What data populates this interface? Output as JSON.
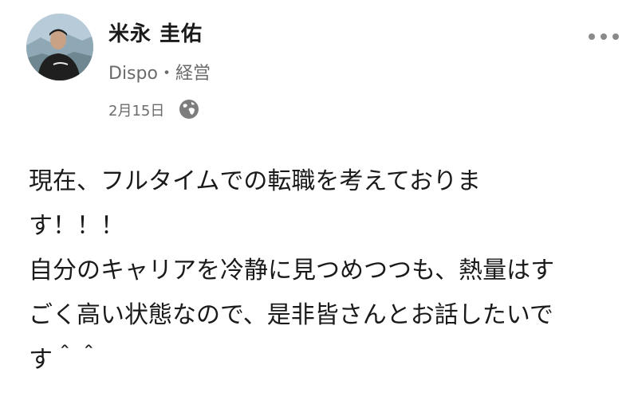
{
  "author": {
    "name": "米永 圭佑",
    "meta": "Dispo・経営"
  },
  "post": {
    "date": "2月15日",
    "lines": [
      "現在、フルタイムでの転職を考えておりま",
      "す！！！",
      "自分のキャリアを冷静に見つめつつも、熱量はす",
      "ごく高い状態なので、是非皆さんとお話したいで",
      "す＾＾"
    ]
  },
  "icons": {
    "visibility": "globe-icon",
    "menu": "more-dots-icon"
  },
  "colors": {
    "text": "#1a1a1a",
    "secondary": "#6b6b6b",
    "icon": "#8a8a8a"
  }
}
